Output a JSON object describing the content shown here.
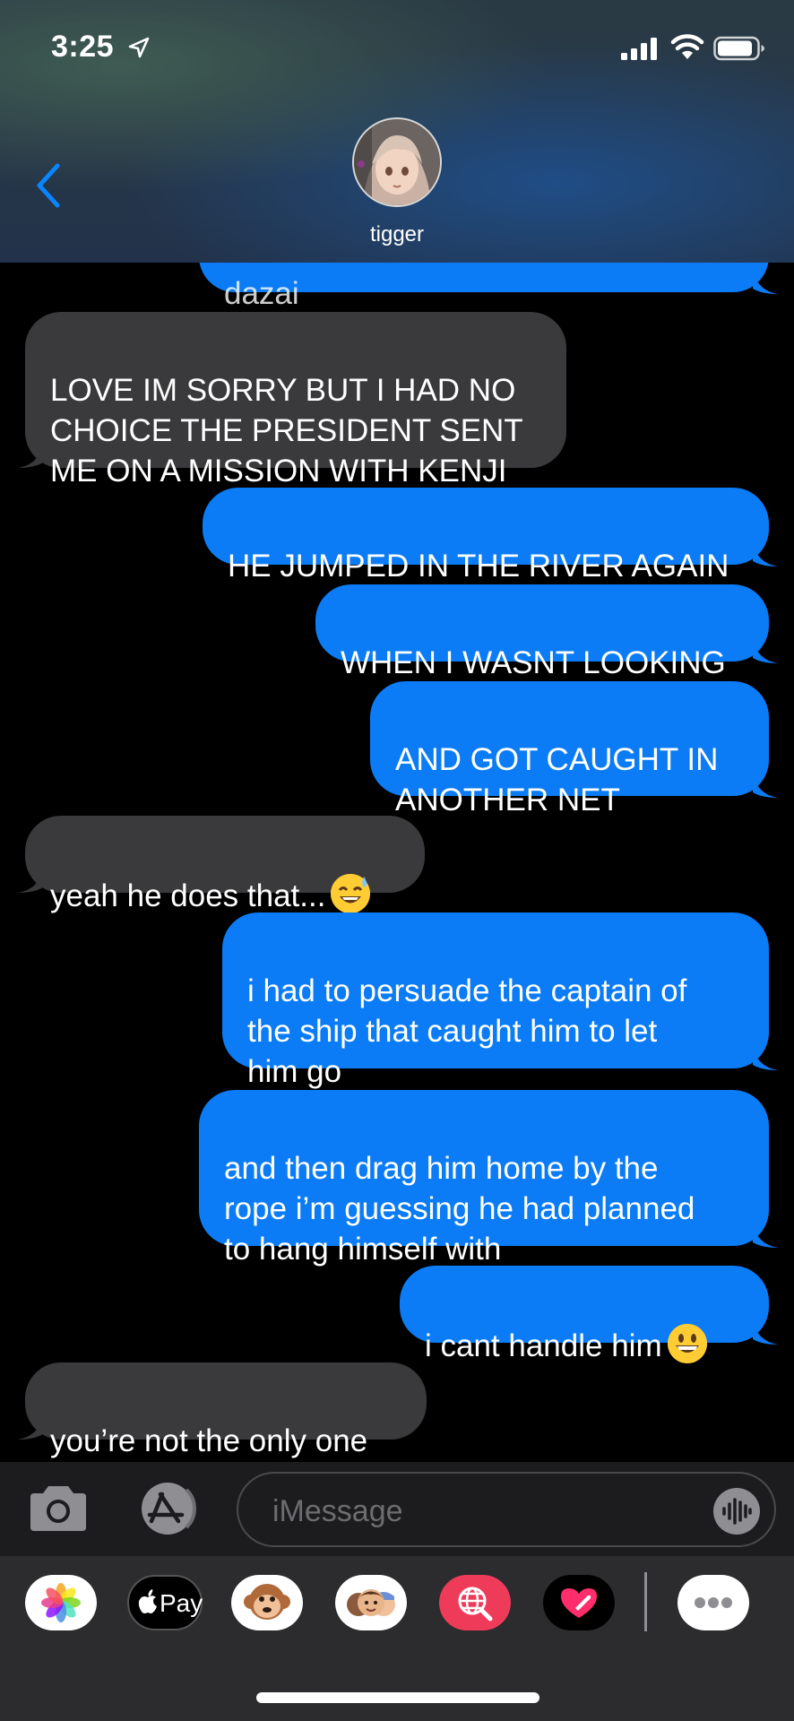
{
  "status_bar": {
    "time": "3:25"
  },
  "header": {
    "contact_name": "tigger"
  },
  "messages": [
    {
      "side": "out",
      "text": "dazai"
    },
    {
      "side": "in",
      "text": "LOVE IM SORRY BUT I HAD NO\nCHOICE THE PRESIDENT SENT\nME ON A MISSION WITH KENJI"
    },
    {
      "side": "out",
      "text": "HE JUMPED IN THE RIVER AGAIN"
    },
    {
      "side": "out",
      "text": "WHEN I WASNT LOOKING"
    },
    {
      "side": "out",
      "text": "AND GOT CAUGHT IN\nANOTHER NET"
    },
    {
      "side": "in",
      "text": "yeah he does that...",
      "emoji": "sweat-smile-emoji"
    },
    {
      "side": "out",
      "text": "i had to persuade the captain of\nthe ship that caught him to let\nhim go"
    },
    {
      "side": "out",
      "text": "and then drag him home by the\nrope i’m guessing he had planned\nto hang himself with"
    },
    {
      "side": "out",
      "text": "i cant handle him",
      "emoji": "grinning-emoji"
    },
    {
      "side": "in",
      "text": "you’re not the only one"
    }
  ],
  "compose": {
    "placeholder": "iMessage"
  },
  "apps": [
    {
      "name": "photos-app"
    },
    {
      "name": "apple-pay-app",
      "label": "Pay"
    },
    {
      "name": "animoji-app"
    },
    {
      "name": "memoji-app"
    },
    {
      "name": "web-search-app"
    },
    {
      "name": "digital-touch-app"
    },
    {
      "name": "more-apps"
    }
  ],
  "colors": {
    "outgoing": "#0b7cf5",
    "incoming": "#3a3a3c",
    "accent": "#0a84ff"
  }
}
